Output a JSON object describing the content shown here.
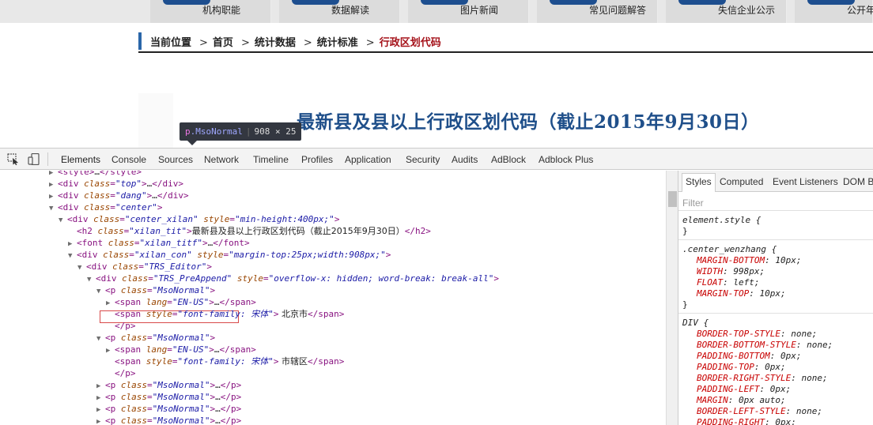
{
  "site": {
    "nav": [
      "机构职能",
      "数据解读",
      "图片新闻",
      "常见问题解答",
      "失信企业公示",
      "公开年"
    ],
    "breadcrumb": {
      "label": "当前位置",
      "items": [
        "首页",
        "统计数据",
        "统计标准"
      ],
      "current": "行政区划代码",
      "separator": ">"
    },
    "title": "最新县及县以上行政区划代码（截止2015年9月30日）",
    "tooltip": {
      "tag": "p",
      "class": ".MsoNormal",
      "size": "908 × 25"
    }
  },
  "devtools": {
    "tabs": [
      "Elements",
      "Console",
      "Sources",
      "Network",
      "Timeline",
      "Profiles",
      "Application",
      "Security",
      "Audits",
      "AdBlock",
      "Adblock Plus"
    ],
    "active_tab": "Elements",
    "dom": [
      {
        "tri": "▶",
        "parts": [
          [
            "tag",
            "<style>"
          ],
          [
            "ell",
            "…"
          ],
          [
            "tag",
            "</style>"
          ]
        ]
      },
      {
        "tri": "▶",
        "parts": [
          [
            "tag",
            "<div "
          ],
          [
            "attr",
            "class"
          ],
          [
            "tag",
            "="
          ],
          [
            "val",
            "\"top\""
          ],
          [
            "tag",
            ">"
          ],
          [
            "ell",
            "…"
          ],
          [
            "tag",
            "</div>"
          ]
        ]
      },
      {
        "tri": "▶",
        "parts": [
          [
            "tag",
            "<div "
          ],
          [
            "attr",
            "class"
          ],
          [
            "tag",
            "="
          ],
          [
            "val",
            "\"dang\""
          ],
          [
            "tag",
            ">"
          ],
          [
            "ell",
            "…"
          ],
          [
            "tag",
            "</div>"
          ]
        ]
      },
      {
        "tri": "▼",
        "parts": [
          [
            "tag",
            "<div "
          ],
          [
            "attr",
            "class"
          ],
          [
            "tag",
            "="
          ],
          [
            "val",
            "\"center\""
          ],
          [
            "tag",
            ">"
          ]
        ]
      },
      {
        "tri": "▼",
        "parts": [
          [
            "tag",
            "<div "
          ],
          [
            "attr",
            "class"
          ],
          [
            "tag",
            "="
          ],
          [
            "val",
            "\"center_xilan\""
          ],
          [
            "tag",
            " "
          ],
          [
            "attr",
            "style"
          ],
          [
            "tag",
            "="
          ],
          [
            "val",
            "\"min-height:400px;\""
          ],
          [
            "tag",
            ">"
          ]
        ]
      },
      {
        "tri": "",
        "parts": [
          [
            "tag",
            "<h2 "
          ],
          [
            "attr",
            "class"
          ],
          [
            "tag",
            "="
          ],
          [
            "val",
            "\"xilan_tit\""
          ],
          [
            "tag",
            ">"
          ],
          [
            "txt",
            "最新县及县以上行政区划代码（截止2015年9月30日）"
          ],
          [
            "tag",
            "</h2>"
          ]
        ]
      },
      {
        "tri": "▶",
        "parts": [
          [
            "tag",
            "<font "
          ],
          [
            "attr",
            "class"
          ],
          [
            "tag",
            "="
          ],
          [
            "val",
            "\"xilan_titf\""
          ],
          [
            "tag",
            ">"
          ],
          [
            "ell",
            "…"
          ],
          [
            "tag",
            "</font>"
          ]
        ]
      },
      {
        "tri": "▼",
        "parts": [
          [
            "tag",
            "<div "
          ],
          [
            "attr",
            "class"
          ],
          [
            "tag",
            "="
          ],
          [
            "val",
            "\"xilan_con\""
          ],
          [
            "tag",
            " "
          ],
          [
            "attr",
            "style"
          ],
          [
            "tag",
            "="
          ],
          [
            "val",
            "\"margin-top:25px;width:908px;\""
          ],
          [
            "tag",
            ">"
          ]
        ]
      },
      {
        "tri": "▼",
        "parts": [
          [
            "tag",
            "<div "
          ],
          [
            "attr",
            "class"
          ],
          [
            "tag",
            "="
          ],
          [
            "val",
            "\"TRS_Editor\""
          ],
          [
            "tag",
            ">"
          ]
        ]
      },
      {
        "tri": "▼",
        "parts": [
          [
            "tag",
            "<div "
          ],
          [
            "attr",
            "class"
          ],
          [
            "tag",
            "="
          ],
          [
            "val",
            "\"TRS_PreAppend\""
          ],
          [
            "tag",
            " "
          ],
          [
            "attr",
            "style"
          ],
          [
            "tag",
            "="
          ],
          [
            "val",
            "\"overflow-x: hidden; word-break: break-all\""
          ],
          [
            "tag",
            ">"
          ]
        ]
      },
      {
        "tri": "▼",
        "parts": [
          [
            "tag",
            "<p "
          ],
          [
            "attr",
            "class"
          ],
          [
            "tag",
            "="
          ],
          [
            "val",
            "\"MsoNormal\""
          ],
          [
            "tag",
            ">"
          ]
        ]
      },
      {
        "tri": "▶",
        "parts": [
          [
            "tag",
            "<span "
          ],
          [
            "attr",
            "lang"
          ],
          [
            "tag",
            "="
          ],
          [
            "val",
            "\"EN-US\""
          ],
          [
            "tag",
            ">"
          ],
          [
            "ell",
            "…"
          ],
          [
            "tag",
            "</span>"
          ]
        ]
      },
      {
        "tri": "",
        "parts": [
          [
            "tag",
            "<span "
          ],
          [
            "attr",
            "style"
          ],
          [
            "tag",
            "="
          ],
          [
            "val",
            "\"font-family: 宋体\""
          ],
          [
            "tag",
            ">"
          ],
          [
            "txt",
            "  北京市"
          ],
          [
            "tag",
            "</span>"
          ]
        ]
      },
      {
        "tri": "",
        "parts": [
          [
            "tag",
            "</p>"
          ]
        ]
      },
      {
        "tri": "▼",
        "parts": [
          [
            "tag",
            "<p "
          ],
          [
            "attr",
            "class"
          ],
          [
            "tag",
            "="
          ],
          [
            "val",
            "\"MsoNormal\""
          ],
          [
            "tag",
            ">"
          ]
        ]
      },
      {
        "tri": "▶",
        "parts": [
          [
            "tag",
            "<span "
          ],
          [
            "attr",
            "lang"
          ],
          [
            "tag",
            "="
          ],
          [
            "val",
            "\"EN-US\""
          ],
          [
            "tag",
            ">"
          ],
          [
            "ell",
            "…"
          ],
          [
            "tag",
            "</span>"
          ]
        ]
      },
      {
        "tri": "",
        "parts": [
          [
            "tag",
            "<span "
          ],
          [
            "attr",
            "style"
          ],
          [
            "tag",
            "="
          ],
          [
            "val",
            "\"font-family: 宋体\""
          ],
          [
            "tag",
            ">"
          ],
          [
            "txt",
            "    市辖区"
          ],
          [
            "tag",
            "</span>"
          ]
        ]
      },
      {
        "tri": "",
        "parts": [
          [
            "tag",
            "</p>"
          ]
        ]
      },
      {
        "tri": "▶",
        "parts": [
          [
            "tag",
            "<p "
          ],
          [
            "attr",
            "class"
          ],
          [
            "tag",
            "="
          ],
          [
            "val",
            "\"MsoNormal\""
          ],
          [
            "tag",
            ">"
          ],
          [
            "ell",
            "…"
          ],
          [
            "tag",
            "</p>"
          ]
        ]
      },
      {
        "tri": "▶",
        "parts": [
          [
            "tag",
            "<p "
          ],
          [
            "attr",
            "class"
          ],
          [
            "tag",
            "="
          ],
          [
            "val",
            "\"MsoNormal\""
          ],
          [
            "tag",
            ">"
          ],
          [
            "ell",
            "…"
          ],
          [
            "tag",
            "</p>"
          ]
        ]
      },
      {
        "tri": "▶",
        "parts": [
          [
            "tag",
            "<p "
          ],
          [
            "attr",
            "class"
          ],
          [
            "tag",
            "="
          ],
          [
            "val",
            "\"MsoNormal\""
          ],
          [
            "tag",
            ">"
          ],
          [
            "ell",
            "…"
          ],
          [
            "tag",
            "</p>"
          ]
        ]
      },
      {
        "tri": "▶",
        "parts": [
          [
            "tag",
            "<p "
          ],
          [
            "attr",
            "class"
          ],
          [
            "tag",
            "="
          ],
          [
            "val",
            "\"MsoNormal\""
          ],
          [
            "tag",
            ">"
          ],
          [
            "ell",
            "…"
          ],
          [
            "tag",
            "</p>"
          ]
        ]
      }
    ],
    "styles_tabs": [
      "Styles",
      "Computed",
      "Event Listeners",
      "DOM B"
    ],
    "filter_placeholder": "Filter",
    "rules": [
      {
        "selector": "element.style {",
        "props": [],
        "close": "}"
      },
      {
        "selector": ".center_wenzhang {",
        "props": [
          [
            "MARGIN-BOTTOM",
            "10px;"
          ],
          [
            "WIDTH",
            "998px;"
          ],
          [
            "FLOAT",
            "left;"
          ],
          [
            "MARGIN-TOP",
            "10px;"
          ]
        ],
        "close": "}"
      },
      {
        "selector": "DIV {",
        "props": [
          [
            "BORDER-TOP-STYLE",
            "none;"
          ],
          [
            "BORDER-BOTTOM-STYLE",
            "none;"
          ],
          [
            "PADDING-BOTTOM",
            "0px;"
          ],
          [
            "PADDING-TOP",
            "0px;"
          ],
          [
            "BORDER-RIGHT-STYLE",
            "none;"
          ],
          [
            "PADDING-LEFT",
            "0px;"
          ],
          [
            "MARGIN",
            "0px auto;"
          ],
          [
            "BORDER-LEFT-STYLE",
            "none;"
          ],
          [
            "PADDING-RIGHT",
            "0px;"
          ]
        ],
        "close": ""
      }
    ],
    "colors": {
      "tag": "#881280",
      "attr": "#994500",
      "value": "#1a1aa6",
      "css_prop": "#c80000",
      "crumb_current": "#a5121a",
      "title": "#1f4f8a"
    }
  }
}
